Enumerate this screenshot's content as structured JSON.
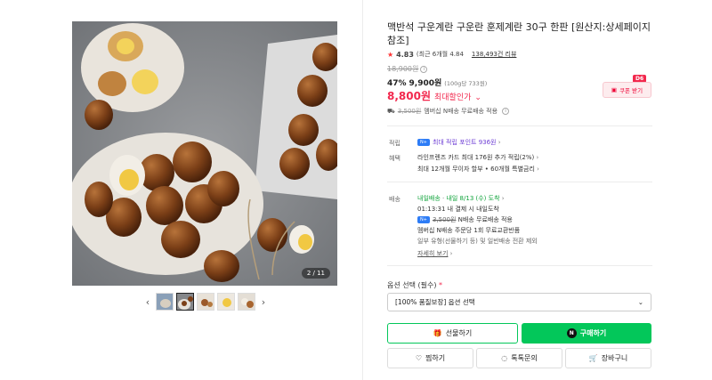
{
  "gallery": {
    "counter": "2 / 11",
    "prev_icon": "chevron-left-icon",
    "next_icon": "chevron-right-icon",
    "thumbnail_count": 5,
    "active_thumbnail": 2
  },
  "product": {
    "title": "맥반석 구운계란 구운란 훈제계란 30구 한판 [원산지:상세페이지 참조]",
    "rating": "4.83",
    "rating_recent": "(최근 6개월 4.84",
    "review_count": "138,493건 리뷰",
    "original_price": "18,900원",
    "discount_rate": "47%",
    "sale_price": "9,900원",
    "unit_price": "(100g당 733원)",
    "final_price": "8,800원",
    "final_label": "최대할인가",
    "coupon_label": "쿠폰 받기",
    "coupon_badge": "D6",
    "shipping_old": "3,500원",
    "shipping_text": "멤버십 N배송 무료배송 적용"
  },
  "details": {
    "points_label": "적립",
    "points_text": "최대 적립 포인트 936원",
    "benefit_label": "혜택",
    "benefit_line1": "라인프렌즈 카드 최대 176원 추가 적립(2%)",
    "benefit_line2": "최대 12개월 무이자 할부 • 60개월 특별금리",
    "delivery_label": "배송",
    "delivery_badge": "내일배송",
    "delivery_date": "내일 8/13 (수) 도착",
    "delivery_countdown": "01:13:31  내 결제 시 내일도착",
    "delivery_old": "3,500원",
    "delivery_free": "N배송 무료배송 적용",
    "delivery_exchange": "멤버십 N배송 주문당 1회 무료교환반품",
    "delivery_note": "일부 유형(선물하기 등) 및 일반배송 전환 제외",
    "delivery_more": "자세히 보기"
  },
  "options": {
    "label": "옵션 선택 (필수)",
    "required_mark": "*",
    "selected": "[100% 품질보장] 옵션 선택"
  },
  "buttons": {
    "gift": "선물하기",
    "buy": "구매하기",
    "wish": "찜하기",
    "talk": "톡톡문의",
    "cart": "장바구니"
  },
  "colors": {
    "accent_red": "#f2284d",
    "naver_green": "#03c75a",
    "npay_blue": "#2d7cf6",
    "points_purple": "#6c3cd4"
  }
}
